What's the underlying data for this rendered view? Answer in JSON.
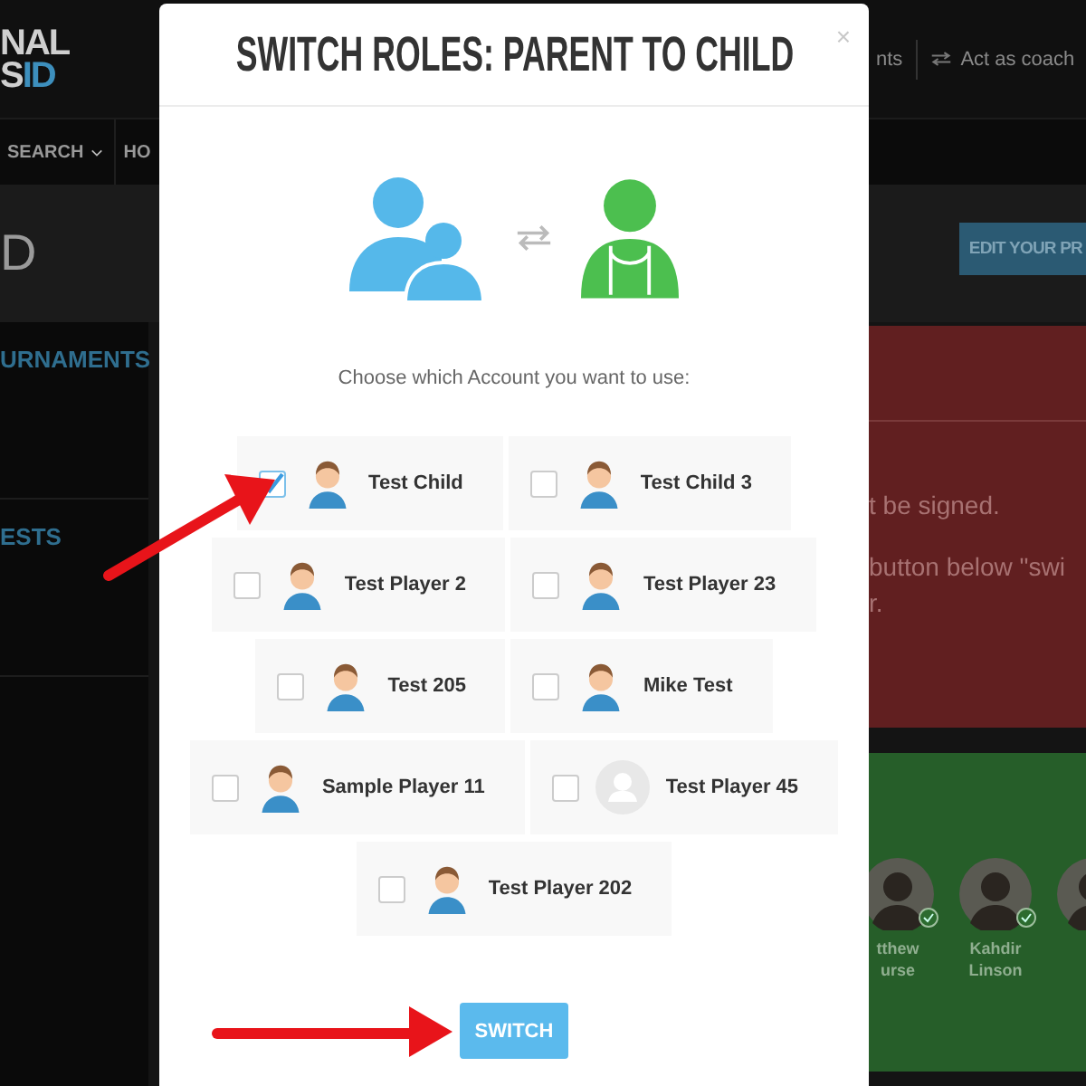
{
  "background_page": {
    "logo": {
      "line_1": "NAL",
      "line_2_white": "S",
      "line_2_blue": "ID"
    },
    "header_links": [
      "nts",
      "Act as coach"
    ],
    "nav_items": [
      {
        "label": "SEARCH",
        "dropdown": true
      },
      {
        "label": "HO",
        "dropdown": false
      }
    ],
    "page_heading": "D",
    "edit_button": "EDIT YOUR PR",
    "sidebar_items": [
      "URNAMENTS",
      "ESTS"
    ],
    "notice_lines": [
      "t be signed.",
      "button below \"swi",
      "r."
    ],
    "players": [
      {
        "name_lines": [
          "tthew",
          "urse"
        ],
        "verified": true
      },
      {
        "name_lines": [
          "Kahdir",
          "Linson"
        ],
        "verified": true
      }
    ]
  },
  "modal": {
    "title": "SWITCH ROLES: PARENT TO CHILD",
    "close": "×",
    "prompt": "Choose which Account you want to use:",
    "account_rows": [
      [
        {
          "name": "Test Child",
          "selected": true,
          "kind": "cartoon"
        },
        {
          "name": "Test Child 3",
          "selected": false,
          "kind": "cartoon"
        }
      ],
      [
        {
          "name": "Test Player 2",
          "selected": false,
          "kind": "cartoon"
        },
        {
          "name": "Test Player 23",
          "selected": false,
          "kind": "cartoon"
        }
      ],
      [
        {
          "name": "Test 205",
          "selected": false,
          "kind": "cartoon"
        },
        {
          "name": "Mike Test",
          "selected": false,
          "kind": "cartoon"
        }
      ],
      [
        {
          "name": "Sample Player 11",
          "selected": false,
          "kind": "cartoon"
        },
        {
          "name": "Test Player 45",
          "selected": false,
          "kind": "placeholder"
        }
      ],
      [
        {
          "name": "Test Player 202",
          "selected": false,
          "kind": "cartoon"
        }
      ]
    ],
    "button": "SWITCH"
  }
}
